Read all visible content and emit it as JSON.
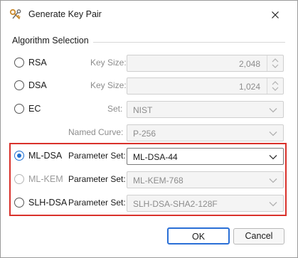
{
  "window": {
    "title": "Generate Key Pair"
  },
  "algorithm_section": {
    "title": "Algorithm Selection"
  },
  "rsa": {
    "label": "RSA",
    "field_label": "Key Size:",
    "value": "2,048"
  },
  "dsa": {
    "label": "DSA",
    "field_label": "Key Size:",
    "value": "1,024"
  },
  "ec": {
    "label": "EC",
    "set_label": "Set:",
    "set_value": "NIST",
    "curve_label": "Named Curve:",
    "curve_value": "P-256"
  },
  "mldsa": {
    "label": "ML-DSA",
    "field_label": "Parameter Set:",
    "value": "ML-DSA-44",
    "selected": true
  },
  "mlkem": {
    "label": "ML-KEM",
    "field_label": "Parameter Set:",
    "value": "ML-KEM-768",
    "enabled": false
  },
  "slhdsa": {
    "label": "SLH-DSA",
    "field_label": "Parameter Set:",
    "value": "SLH-DSA-SHA2-128F"
  },
  "buttons": {
    "ok": "OK",
    "cancel": "Cancel"
  },
  "colors": {
    "accent": "#1f6fd1",
    "highlight_box": "#d9312b",
    "disabled_text": "#8c8c8c"
  },
  "icons": {
    "app": "key-pair-icon",
    "close": "close-icon",
    "dropdown": "chevron-down-icon",
    "spinner": "spinner-icon"
  }
}
